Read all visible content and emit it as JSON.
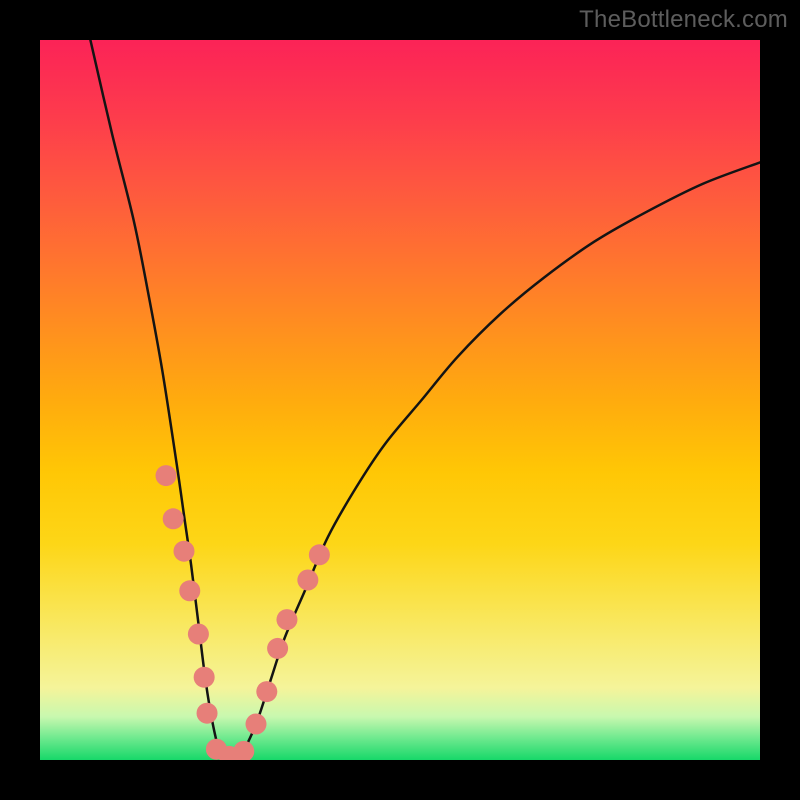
{
  "meta": {
    "watermark": "TheBottleneck.com"
  },
  "colors": {
    "curve_stroke": "#141414",
    "dot_fill": "#e77f79",
    "dot_stroke": "#c46761",
    "frame_bg": "#000000"
  },
  "chart_data": {
    "type": "line",
    "title": "",
    "xlabel": "",
    "ylabel": "",
    "xlim": [
      0,
      100
    ],
    "ylim": [
      0,
      100
    ],
    "grid": false,
    "series": [
      {
        "name": "bottleneck-curve",
        "x": [
          7,
          10,
          13,
          15,
          17,
          19,
          20,
          21,
          22,
          23,
          24,
          25,
          26,
          28,
          30,
          32,
          34,
          37,
          40,
          44,
          48,
          53,
          58,
          64,
          70,
          77,
          84,
          92,
          100
        ],
        "y": [
          100,
          87,
          75,
          65,
          54,
          41,
          34,
          27,
          19,
          11,
          5,
          1,
          0,
          1,
          5,
          11,
          17,
          24,
          31,
          38,
          44,
          50,
          56,
          62,
          67,
          72,
          76,
          80,
          83
        ]
      }
    ],
    "dots": {
      "name": "marked-points",
      "points": [
        {
          "x": 17.5,
          "y": 39.5
        },
        {
          "x": 18.5,
          "y": 33.5
        },
        {
          "x": 20.0,
          "y": 29.0
        },
        {
          "x": 20.8,
          "y": 23.5
        },
        {
          "x": 22.0,
          "y": 17.5
        },
        {
          "x": 22.8,
          "y": 11.5
        },
        {
          "x": 23.2,
          "y": 6.5
        },
        {
          "x": 24.5,
          "y": 1.5
        },
        {
          "x": 26.3,
          "y": 0.5
        },
        {
          "x": 28.3,
          "y": 1.2
        },
        {
          "x": 30.0,
          "y": 5.0
        },
        {
          "x": 31.5,
          "y": 9.5
        },
        {
          "x": 33.0,
          "y": 15.5
        },
        {
          "x": 34.3,
          "y": 19.5
        },
        {
          "x": 37.2,
          "y": 25.0
        },
        {
          "x": 38.8,
          "y": 28.5
        }
      ],
      "radius": 10.5
    }
  }
}
